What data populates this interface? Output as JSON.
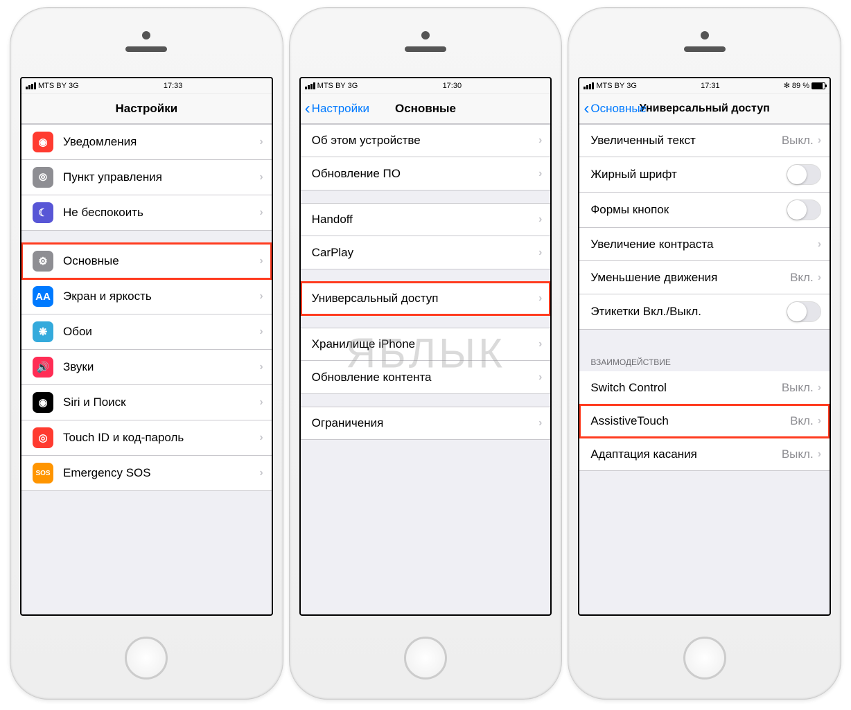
{
  "status": {
    "carrier": "MTS BY",
    "network": "3G",
    "bluetooth": "✻",
    "battery": "89 %"
  },
  "screen1": {
    "time": "17:33",
    "title": "Настройки",
    "groupA": [
      {
        "icon": "red",
        "glyph": "◉",
        "label": "Уведомления"
      },
      {
        "icon": "gray",
        "glyph": "⦾",
        "label": "Пункт управления"
      },
      {
        "icon": "purple",
        "glyph": "☾",
        "label": "Не беспокоить"
      }
    ],
    "groupB": [
      {
        "icon": "gray",
        "glyph": "⚙",
        "label": "Основные",
        "hl": true
      },
      {
        "icon": "blue",
        "glyph": "AA",
        "label": "Экран и яркость"
      },
      {
        "icon": "cyan",
        "glyph": "❋",
        "label": "Обои"
      },
      {
        "icon": "pink",
        "glyph": "🔊",
        "label": "Звуки"
      },
      {
        "icon": "black",
        "glyph": "◉",
        "label": "Siri и Поиск"
      },
      {
        "icon": "touchid",
        "glyph": "◎",
        "label": "Touch ID и код-пароль"
      },
      {
        "icon": "orange",
        "glyph": "SOS",
        "label": "Emergency SOS"
      }
    ]
  },
  "screen2": {
    "time": "17:30",
    "back": "Настройки",
    "title": "Основные",
    "groupA": [
      {
        "label": "Об этом устройстве"
      },
      {
        "label": "Обновление ПО"
      }
    ],
    "groupB": [
      {
        "label": "Handoff"
      },
      {
        "label": "CarPlay"
      }
    ],
    "groupC": [
      {
        "label": "Универсальный доступ",
        "hl": true
      }
    ],
    "groupD": [
      {
        "label": "Хранилище iPhone"
      },
      {
        "label": "Обновление контента"
      }
    ],
    "groupE": [
      {
        "label": "Ограничения"
      }
    ]
  },
  "screen3": {
    "time": "17:31",
    "back": "Основные",
    "title": "Универсальный доступ",
    "groupA": [
      {
        "label": "Увеличенный текст",
        "value": "Выкл.",
        "type": "disclosure"
      },
      {
        "label": "Жирный шрифт",
        "type": "switch",
        "on": false
      },
      {
        "label": "Формы кнопок",
        "type": "switch",
        "on": false
      },
      {
        "label": "Увеличение контраста",
        "type": "disclosure"
      },
      {
        "label": "Уменьшение движения",
        "value": "Вкл.",
        "type": "disclosure"
      },
      {
        "label": "Этикетки Вкл./Выкл.",
        "type": "switch",
        "on": false
      }
    ],
    "header": "ВЗАИМОДЕЙСТВИЕ",
    "groupB": [
      {
        "label": "Switch Control",
        "value": "Выкл.",
        "type": "disclosure"
      },
      {
        "label": "AssistiveTouch",
        "value": "Вкл.",
        "type": "disclosure",
        "hl": true
      },
      {
        "label": "Адаптация касания",
        "value": "Выкл.",
        "type": "disclosure"
      }
    ]
  }
}
